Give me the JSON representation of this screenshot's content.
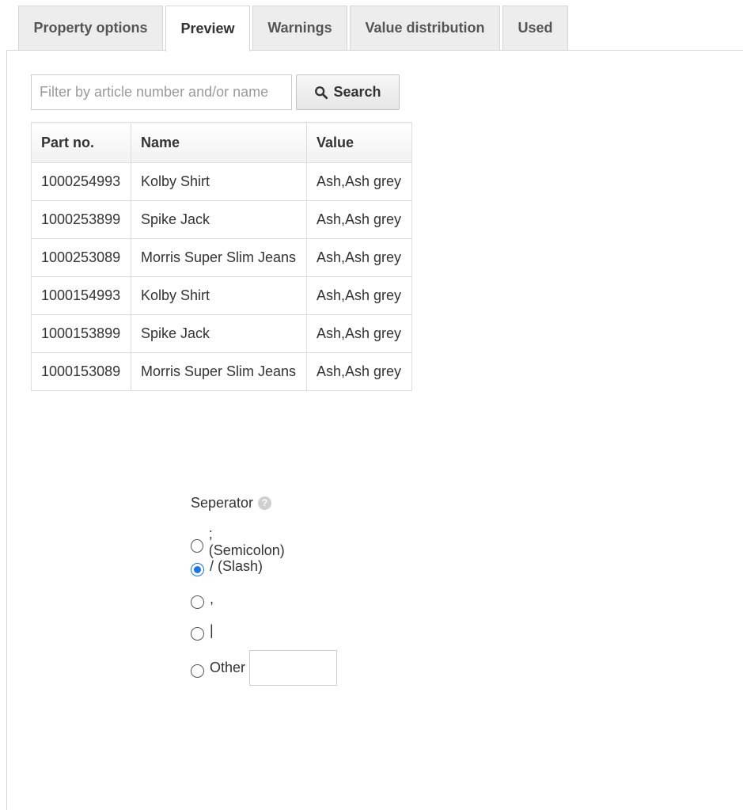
{
  "tabs": [
    {
      "label": "Property options",
      "active": false
    },
    {
      "label": "Preview",
      "active": true
    },
    {
      "label": "Warnings",
      "active": false
    },
    {
      "label": "Value distribution",
      "active": false
    },
    {
      "label": "Used",
      "active": false
    }
  ],
  "search": {
    "placeholder": "Filter by article number and/or name",
    "value": "",
    "button_label": "Search",
    "button_icon": "search-icon"
  },
  "table": {
    "columns": [
      "Part no.",
      "Name",
      "Value"
    ],
    "rows": [
      [
        "1000254993",
        "Kolby Shirt",
        "Ash,Ash grey"
      ],
      [
        "1000253899",
        "Spike Jack",
        "Ash,Ash grey"
      ],
      [
        "1000253089",
        "Morris Super Slim Jeans",
        "Ash,Ash grey"
      ],
      [
        "1000154993",
        "Kolby Shirt",
        "Ash,Ash grey"
      ],
      [
        "1000153899",
        "Spike Jack",
        "Ash,Ash grey"
      ],
      [
        "1000153089",
        "Morris Super Slim Jeans",
        "Ash,Ash grey"
      ]
    ]
  },
  "separator": {
    "label": "Seperator",
    "help_icon": "question-icon",
    "help_glyph": "?",
    "options": [
      {
        "label": "; (Semicolon)",
        "checked": false
      },
      {
        "label": "/ (Slash)",
        "checked": true
      },
      {
        "label": ",",
        "checked": false
      },
      {
        "label": "|",
        "checked": false
      },
      {
        "label": "Other",
        "checked": false
      }
    ],
    "other_value": ""
  },
  "colors": {
    "accent": "#1a73e8",
    "tab_bg": "#ededed",
    "border": "#d6d6d6"
  }
}
